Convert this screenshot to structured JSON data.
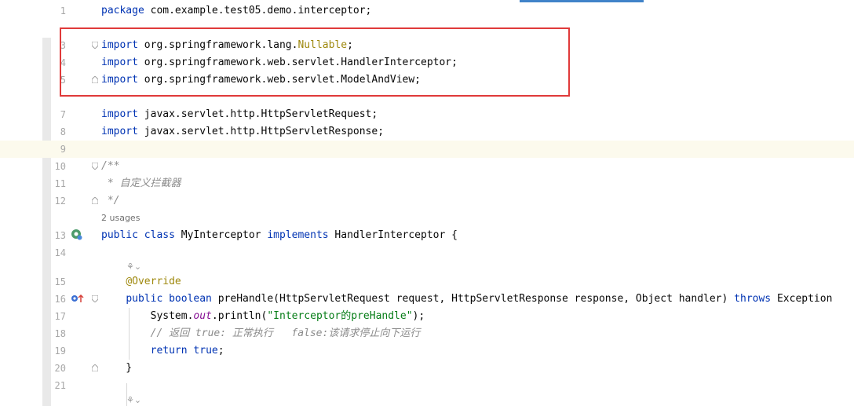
{
  "editor": {
    "usages_label": "2 usages",
    "lines": [
      {
        "n": "1",
        "parts": [
          {
            "t": "package ",
            "c": "kw"
          },
          {
            "t": "com.example.test05.demo.interceptor;"
          }
        ]
      },
      {
        "n": "3",
        "parts": [
          {
            "t": "import ",
            "c": "kw"
          },
          {
            "t": "org.springframework.lang."
          },
          {
            "t": "Nullable",
            "c": "ann"
          },
          {
            "t": ";"
          }
        ]
      },
      {
        "n": "4",
        "parts": [
          {
            "t": "import ",
            "c": "kw"
          },
          {
            "t": "org.springframework.web.servlet.HandlerInterceptor;"
          }
        ]
      },
      {
        "n": "5",
        "parts": [
          {
            "t": "import ",
            "c": "kw"
          },
          {
            "t": "org.springframework.web.servlet.ModelAndView;"
          }
        ]
      },
      {
        "n": "7",
        "parts": [
          {
            "t": "import ",
            "c": "kw"
          },
          {
            "t": "javax.servlet.http.HttpServletRequest;"
          }
        ]
      },
      {
        "n": "8",
        "parts": [
          {
            "t": "import ",
            "c": "kw"
          },
          {
            "t": "javax.servlet.http.HttpServletResponse;"
          }
        ]
      },
      {
        "n": "9",
        "parts": []
      },
      {
        "n": "10",
        "parts": [
          {
            "t": "/**",
            "c": "cmt"
          }
        ]
      },
      {
        "n": "11",
        "parts": [
          {
            "t": " * 自定义拦截器",
            "c": "cmt"
          }
        ]
      },
      {
        "n": "12",
        "parts": [
          {
            "t": " */",
            "c": "cmt"
          }
        ]
      },
      {
        "n": "13",
        "parts": [
          {
            "t": "public class ",
            "c": "kw"
          },
          {
            "t": "MyInterceptor "
          },
          {
            "t": "implements ",
            "c": "kw"
          },
          {
            "t": "HandlerInterceptor {"
          }
        ]
      },
      {
        "n": "14",
        "parts": []
      },
      {
        "n": "15",
        "parts": [
          {
            "t": "    "
          },
          {
            "t": "@Override",
            "c": "ann"
          }
        ]
      },
      {
        "n": "16",
        "parts": [
          {
            "t": "    "
          },
          {
            "t": "public boolean ",
            "c": "kw"
          },
          {
            "t": "preHandle(HttpServletRequest request, HttpServletResponse response, Object handler) "
          },
          {
            "t": "throws ",
            "c": "kw"
          },
          {
            "t": "Exception"
          }
        ]
      },
      {
        "n": "17",
        "parts": [
          {
            "t": "        System."
          },
          {
            "t": "out",
            "c": "field"
          },
          {
            "t": ".println("
          },
          {
            "t": "\"Interceptor的preHandle\"",
            "c": "str"
          },
          {
            "t": ");"
          }
        ]
      },
      {
        "n": "18",
        "parts": [
          {
            "t": "        "
          },
          {
            "t": "// 返回 true: 正常执行   false:该请求停止向下运行",
            "c": "cmt"
          }
        ]
      },
      {
        "n": "19",
        "parts": [
          {
            "t": "        "
          },
          {
            "t": "return true",
            "c": "kw"
          },
          {
            "t": ";"
          }
        ]
      },
      {
        "n": "20",
        "parts": [
          {
            "t": "    }"
          }
        ]
      },
      {
        "n": "21",
        "parts": []
      }
    ]
  },
  "gutter_icons": {
    "class_line": "implementation-icon",
    "method_line": "override-up-arrow-icon"
  },
  "hint_glyph": "⚘⌄"
}
